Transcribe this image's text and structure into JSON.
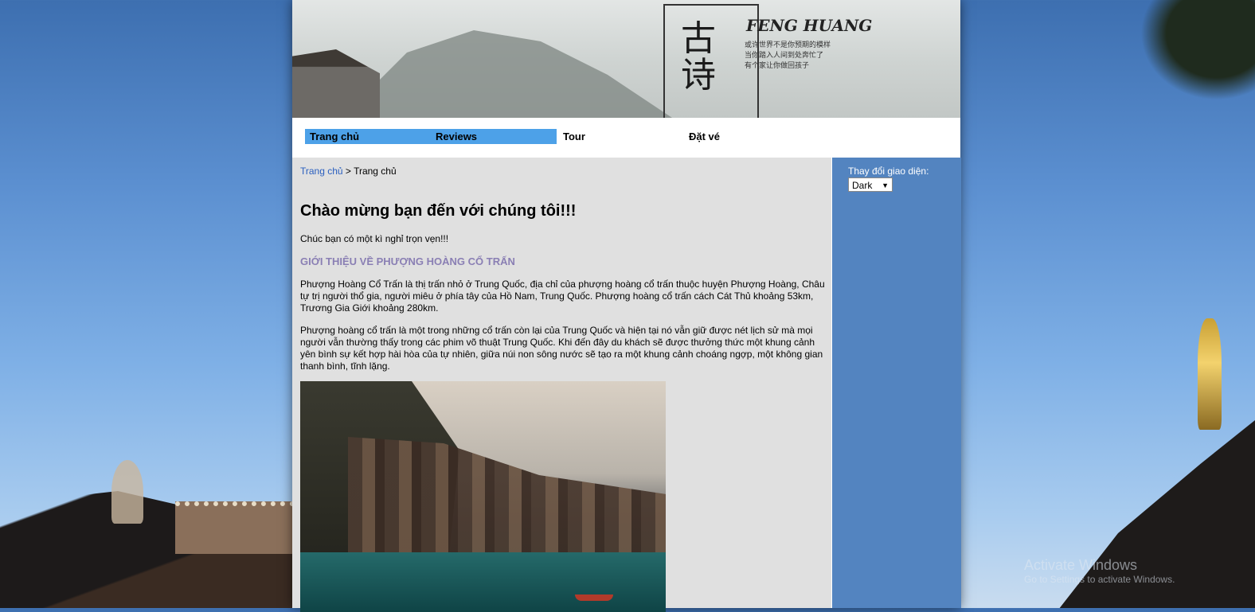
{
  "banner": {
    "title": "FENG HUANG",
    "calligraphy": "古诗",
    "subtitle_lines": [
      "或许世界不是你预期的模样",
      "当你踏入人间到处奔忙了",
      "有个家让你做回孩子"
    ]
  },
  "nav": {
    "items": [
      {
        "label": "Trang chủ",
        "active": true
      },
      {
        "label": "Reviews",
        "active": true
      },
      {
        "label": "Tour",
        "active": false
      },
      {
        "label": "Đặt vé",
        "active": false
      }
    ]
  },
  "breadcrumb": {
    "link": "Trang chủ",
    "separator": " > ",
    "current": "Trang chủ"
  },
  "main": {
    "heading": "Chào mừng bạn đến với chúng tôi!!!",
    "lead": "Chúc bạn có một kì nghỉ trọn vẹn!!!",
    "section_title": "GIỚI THIỆU VỀ PHƯỢNG HOÀNG CỔ TRẤN",
    "paragraph1": "Phượng Hoàng Cổ Trấn là thị trấn nhỏ ở Trung Quốc, địa chỉ của phượng hoàng cổ trấn thuộc huyện Phượng Hoàng, Châu tự trị người thổ gia, người miêu ở phía tây của Hồ Nam, Trung Quốc. Phượng hoàng cổ trấn cách Cát Thủ khoảng 53km, Trương Gia Giới khoảng 280km.",
    "paragraph2": "Phượng hoàng cổ trấn là một trong những cổ trấn còn lại của Trung Quốc và hiện tại nó vẫn giữ được nét lịch sử mà mọi người vẫn thường thấy trong các phim võ thuật Trung Quốc. Khi đến đây du khách sẽ được thưởng thức một khung cảnh yên bình sự kết hợp hài hòa của tự nhiên, giữa núi non sông nước sẽ tạo ra một khung cảnh choáng ngợp, một không gian thanh bình, tĩnh lặng."
  },
  "sidebar": {
    "theme_label": "Thay đổi giao diện:",
    "theme_selected": "Dark"
  },
  "os_watermark": {
    "title": "Activate Windows",
    "subtitle": "Go to Settings to activate Windows."
  }
}
